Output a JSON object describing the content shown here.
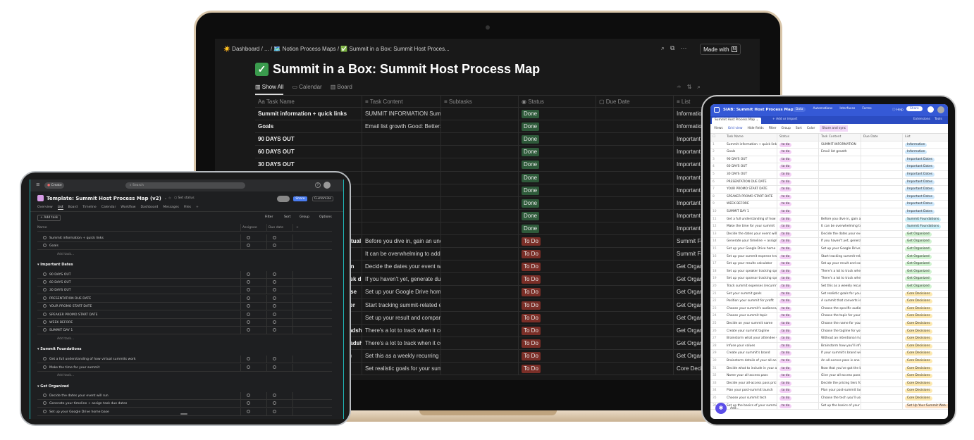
{
  "notion": {
    "breadcrumb": [
      "☀️ Dashboard",
      "/",
      "...",
      "/",
      "🗺️ Notion Process Maps",
      "/",
      "✅ Summit in a Box: Summit Host Proces..."
    ],
    "made_with": "Made with",
    "title_icon": "✓",
    "title": "Summit in a Box: Summit Host Process Map",
    "tabs": [
      "Show All",
      "Calendar",
      "Board"
    ],
    "columns": [
      "Aa Task Name",
      "≡ Task Content",
      "≡ Subtasks",
      "◉ Status",
      "▢ Due Date",
      "≡ List"
    ],
    "status_colors": {
      "Done": "#2e5a3a",
      "To Do": "#7a2e27"
    },
    "rows": [
      [
        "Summit information + quick links",
        "SUMMIT INFORMATION Summi",
        "",
        "Done",
        "",
        "Information"
      ],
      [
        "Goals",
        "Email list growth Good: Better: B",
        "",
        "Done",
        "",
        "Information"
      ],
      [
        "90 DAYS OUT",
        "",
        "",
        "Done",
        "",
        "Important Dates"
      ],
      [
        "60 DAYS OUT",
        "",
        "",
        "Done",
        "",
        "Important Dates"
      ],
      [
        "30 DAYS OUT",
        "",
        "",
        "Done",
        "",
        "Important Dates"
      ],
      [
        "PRESENTATION DUE DATE",
        "",
        "",
        "Done",
        "",
        "Important Dates"
      ],
      [
        "YOUR PROMO START DATE",
        "",
        "",
        "Done",
        "",
        "Important Dates"
      ],
      [
        "SPEAKER PROMO START DATE",
        "",
        "",
        "Done",
        "",
        "Important Dates"
      ],
      [
        "WEEK BEFORE",
        "",
        "",
        "Done",
        "",
        "Important Dates"
      ],
      [
        "SUMMIT DAY 1",
        "",
        "",
        "Done",
        "",
        "Important Dates"
      ],
      [
        "Get a full understanding of how virtual summits work",
        "Before you dive in, gain an understanding",
        "",
        "To Do",
        "",
        "Summit Foundations"
      ],
      [
        "Make the time for your summit",
        "It can be overwhelming to add a",
        "",
        "To Do",
        "",
        "Summit Foundations"
      ],
      [
        "Decide the dates your event will run",
        "Decide the dates your event will",
        "",
        "To Do",
        "",
        "Get Organized"
      ],
      [
        "Generate your timeline + assign task due dates",
        "If you haven't yet, generate due",
        "",
        "To Do",
        "",
        "Get Organized"
      ],
      [
        "Set up your Google Drive home base",
        "Set up your Google Drive home",
        "",
        "To Do",
        "",
        "Get Organized"
      ],
      [
        "Set up your summit expense tracker",
        "Start tracking summit-related e",
        "",
        "To Do",
        "",
        "Get Organized"
      ],
      [
        "Set up your results calculator",
        "Set up your result and comparis",
        "",
        "To Do",
        "",
        "Get Organized"
      ],
      [
        "Set up your speaker tracking spreadsheet",
        "There's a lot to track when it co",
        "",
        "To Do",
        "",
        "Get Organized"
      ],
      [
        "Set up your sponsor tracking spreadsheet",
        "There's a lot to track when it co",
        "",
        "To Do",
        "",
        "Get Organized"
      ],
      [
        "Track summit expenses (recurring)",
        "Set this as a weekly recurring ta",
        "",
        "To Do",
        "",
        "Get Organized"
      ],
      [
        "Set your summit goals",
        "Set realistic goals for your summ",
        "",
        "To Do",
        "",
        "Core Decisions"
      ]
    ]
  },
  "asana": {
    "create": "Create",
    "search": "Search",
    "title": "Template: Summit Host Process Map (v2)",
    "set_status": "Set status",
    "share": "Share",
    "customize": "Customize",
    "tabs": [
      "Overview",
      "List",
      "Board",
      "Timeline",
      "Calendar",
      "Workflow",
      "Dashboard",
      "Messages",
      "Files",
      "+"
    ],
    "add_task": "+ Add task",
    "toolbar": [
      "Filter",
      "Sort",
      "Group",
      "Options"
    ],
    "columns": [
      "Name",
      "Assignee",
      "Due date",
      "+"
    ],
    "items": [
      {
        "t": "task",
        "text": "Summit information + quick links"
      },
      {
        "t": "task",
        "text": "Goals"
      },
      {
        "t": "add",
        "text": "Add task..."
      },
      {
        "t": "section",
        "text": "Important Dates"
      },
      {
        "t": "task",
        "text": "90 DAYS OUT"
      },
      {
        "t": "task",
        "text": "60 DAYS OUT"
      },
      {
        "t": "task",
        "text": "30 DAYS OUT"
      },
      {
        "t": "task",
        "text": "PRESENTATION DUE DATE"
      },
      {
        "t": "task",
        "text": "YOUR PROMO START DATE"
      },
      {
        "t": "task",
        "text": "SPEAKER PROMO START DATE"
      },
      {
        "t": "task",
        "text": "WEEK BEFORE"
      },
      {
        "t": "task",
        "text": "SUMMIT DAY 1"
      },
      {
        "t": "add",
        "text": "Add task..."
      },
      {
        "t": "section",
        "text": "Summit Foundations"
      },
      {
        "t": "task",
        "text": "Get a full understanding of how virtual summits work"
      },
      {
        "t": "task",
        "text": "Make the time for your summit"
      },
      {
        "t": "add",
        "text": "Add task..."
      },
      {
        "t": "section",
        "text": "Get Organized"
      },
      {
        "t": "task",
        "text": "Decide the dates your event will run"
      },
      {
        "t": "task",
        "text": "Generate your timeline + assign task due dates"
      },
      {
        "t": "task",
        "text": "Set up your Google Drive home base"
      }
    ]
  },
  "airtable": {
    "base": "SIAB: Summit Host Process Map",
    "nav": [
      "Data",
      "Automations",
      "Interfaces",
      "Forms"
    ],
    "help": "Help",
    "share": "Share",
    "table_tab": "Summit Host Process Map",
    "add_import": "+ Add or import",
    "extensions": "Extensions",
    "tools": "Tools",
    "toolbar": [
      "Views",
      "Grid view",
      "Hide fields",
      "Filter",
      "Group",
      "Sort",
      "Color",
      "Share and sync"
    ],
    "columns": [
      "Task Name",
      "Status",
      "Task Content",
      "Due Date",
      "List"
    ],
    "add": "Add...",
    "list_colors": {
      "Information": "#cfe8fb",
      "Important Dates": "#cfe8fb",
      "Summit Foundations": "#c9eef7",
      "Get Organized": "#d1f3d1",
      "Core Decisions": "#fde9b0",
      "Set Up Your Summit Web...": "#fde2c6"
    },
    "status_color": "#f3cef5",
    "rows": [
      [
        "Summit information + quick links",
        "to do",
        "SUMMIT INFORMATION",
        "Information"
      ],
      [
        "Goals",
        "to do",
        "Email list growth",
        "Information"
      ],
      [
        "90 DAYS OUT",
        "to do",
        "",
        "Important Dates"
      ],
      [
        "60 DAYS OUT",
        "to do",
        "",
        "Important Dates"
      ],
      [
        "30 DAYS OUT",
        "to do",
        "",
        "Important Dates"
      ],
      [
        "PRESENTATION DUE DATE",
        "to do",
        "",
        "Important Dates"
      ],
      [
        "YOUR PROMO START DATE",
        "to do",
        "",
        "Important Dates"
      ],
      [
        "SPEAKER PROMO START DATE",
        "to do",
        "",
        "Important Dates"
      ],
      [
        "WEEK BEFORE",
        "to do",
        "",
        "Important Dates"
      ],
      [
        "SUMMIT DAY 1",
        "to do",
        "",
        "Important Dates"
      ],
      [
        "Get a full understanding of how vi...",
        "to do",
        "Before you dive in, gain an ...",
        "Summit Foundations"
      ],
      [
        "Make the time for your summit",
        "to do",
        "It can be overwhelming to ...",
        "Summit Foundations"
      ],
      [
        "Decide the dates your event will run",
        "to do",
        "Decide the dates your even...",
        "Get Organized"
      ],
      [
        "Generate your timeline + assign ta...",
        "to do",
        "If you haven't yet, generate...",
        "Get Organized"
      ],
      [
        "Set up your Google Drive home b...",
        "to do",
        "Set up your Google Drive h...",
        "Get Organized"
      ],
      [
        "Set up your summit expense tracker",
        "to do",
        "Start tracking summit-relat...",
        "Get Organized"
      ],
      [
        "Set up your results calculator",
        "to do",
        "Set up your result and com...",
        "Get Organized"
      ],
      [
        "Set up your speaker tracking spre...",
        "to do",
        "There's a lot to track when ...",
        "Get Organized"
      ],
      [
        "Set up your sponsor tracking spre...",
        "to do",
        "There's a lot to track when ...",
        "Get Organized"
      ],
      [
        "Track summit expenses (recurring)",
        "to do",
        "Set this as a weekly recurri...",
        "Get Organized"
      ],
      [
        "Set your summit goals",
        "to do",
        "Set realistic goals for your s...",
        "Core Decisions"
      ],
      [
        "Position your summit for profit",
        "to do",
        "A summit that converts is a...",
        "Core Decisions"
      ],
      [
        "Choose your summit's audience/n...",
        "to do",
        "Choose the specific audien...",
        "Core Decisions"
      ],
      [
        "Choose your summit topic",
        "to do",
        "Choose the topic for your s...",
        "Core Decisions"
      ],
      [
        "Decide on your summit name",
        "to do",
        "Choose the name for your ...",
        "Core Decisions"
      ],
      [
        "Create your summit tagline",
        "to do",
        "Choose the tagline for your...",
        "Core Decisions"
      ],
      [
        "Brainstorm what your attendee wa...",
        "to do",
        "Without an intentional map...",
        "Core Decisions"
      ],
      [
        "Infuse your values",
        "to do",
        "Brainstorm how you'll infus...",
        "Core Decisions"
      ],
      [
        "Create your summit's brand",
        "to do",
        "If your summit's brand will ...",
        "Core Decisions"
      ],
      [
        "Brainstorm details of your all-acce...",
        "to do",
        "An all-access pass is one of...",
        "Core Decisions"
      ],
      [
        "Decide what to include in your all-...",
        "to do",
        "Now that you've got the ba...",
        "Core Decisions"
      ],
      [
        "Name your all-access pass",
        "to do",
        "Give your all-access pass a...",
        "Core Decisions"
      ],
      [
        "Decide your all-access pass pricing",
        "to do",
        "Decide the pricing tiers for...",
        "Core Decisions"
      ],
      [
        "Plan your post-summit launch",
        "to do",
        "Plan your post-summit lau...",
        "Core Decisions"
      ],
      [
        "Choose your summit tech",
        "to do",
        "Choose the tech you'll use ...",
        "Core Decisions"
      ],
      [
        "Set up the basics of your summit's ...",
        "to do",
        "Set up the basics of your s...",
        "Set Up Your Summit Web..."
      ]
    ]
  }
}
